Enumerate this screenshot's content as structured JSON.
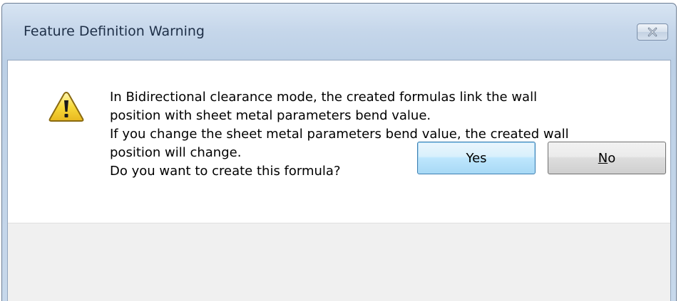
{
  "window": {
    "title": "Feature Definition Warning",
    "close_label": "Close"
  },
  "message": {
    "lines": [
      "In Bidirectional clearance mode, the created formulas link the wall",
      "position with sheet metal parameters bend value.",
      "If you change the sheet metal parameters bend value, the created wall",
      "position will change.",
      "Do you want to create this formula?"
    ]
  },
  "buttons": {
    "yes_label": "Yes",
    "no_mnemonic": "N",
    "no_rest": "o"
  },
  "icons": {
    "warning": "warning-triangle-icon",
    "close": "close-x-icon"
  },
  "colors": {
    "warning_fill": "#f5d130",
    "warning_outline": "#8a6a10",
    "title_bar": "#c5d6ea",
    "default_button_border": "#3c7fb1"
  }
}
